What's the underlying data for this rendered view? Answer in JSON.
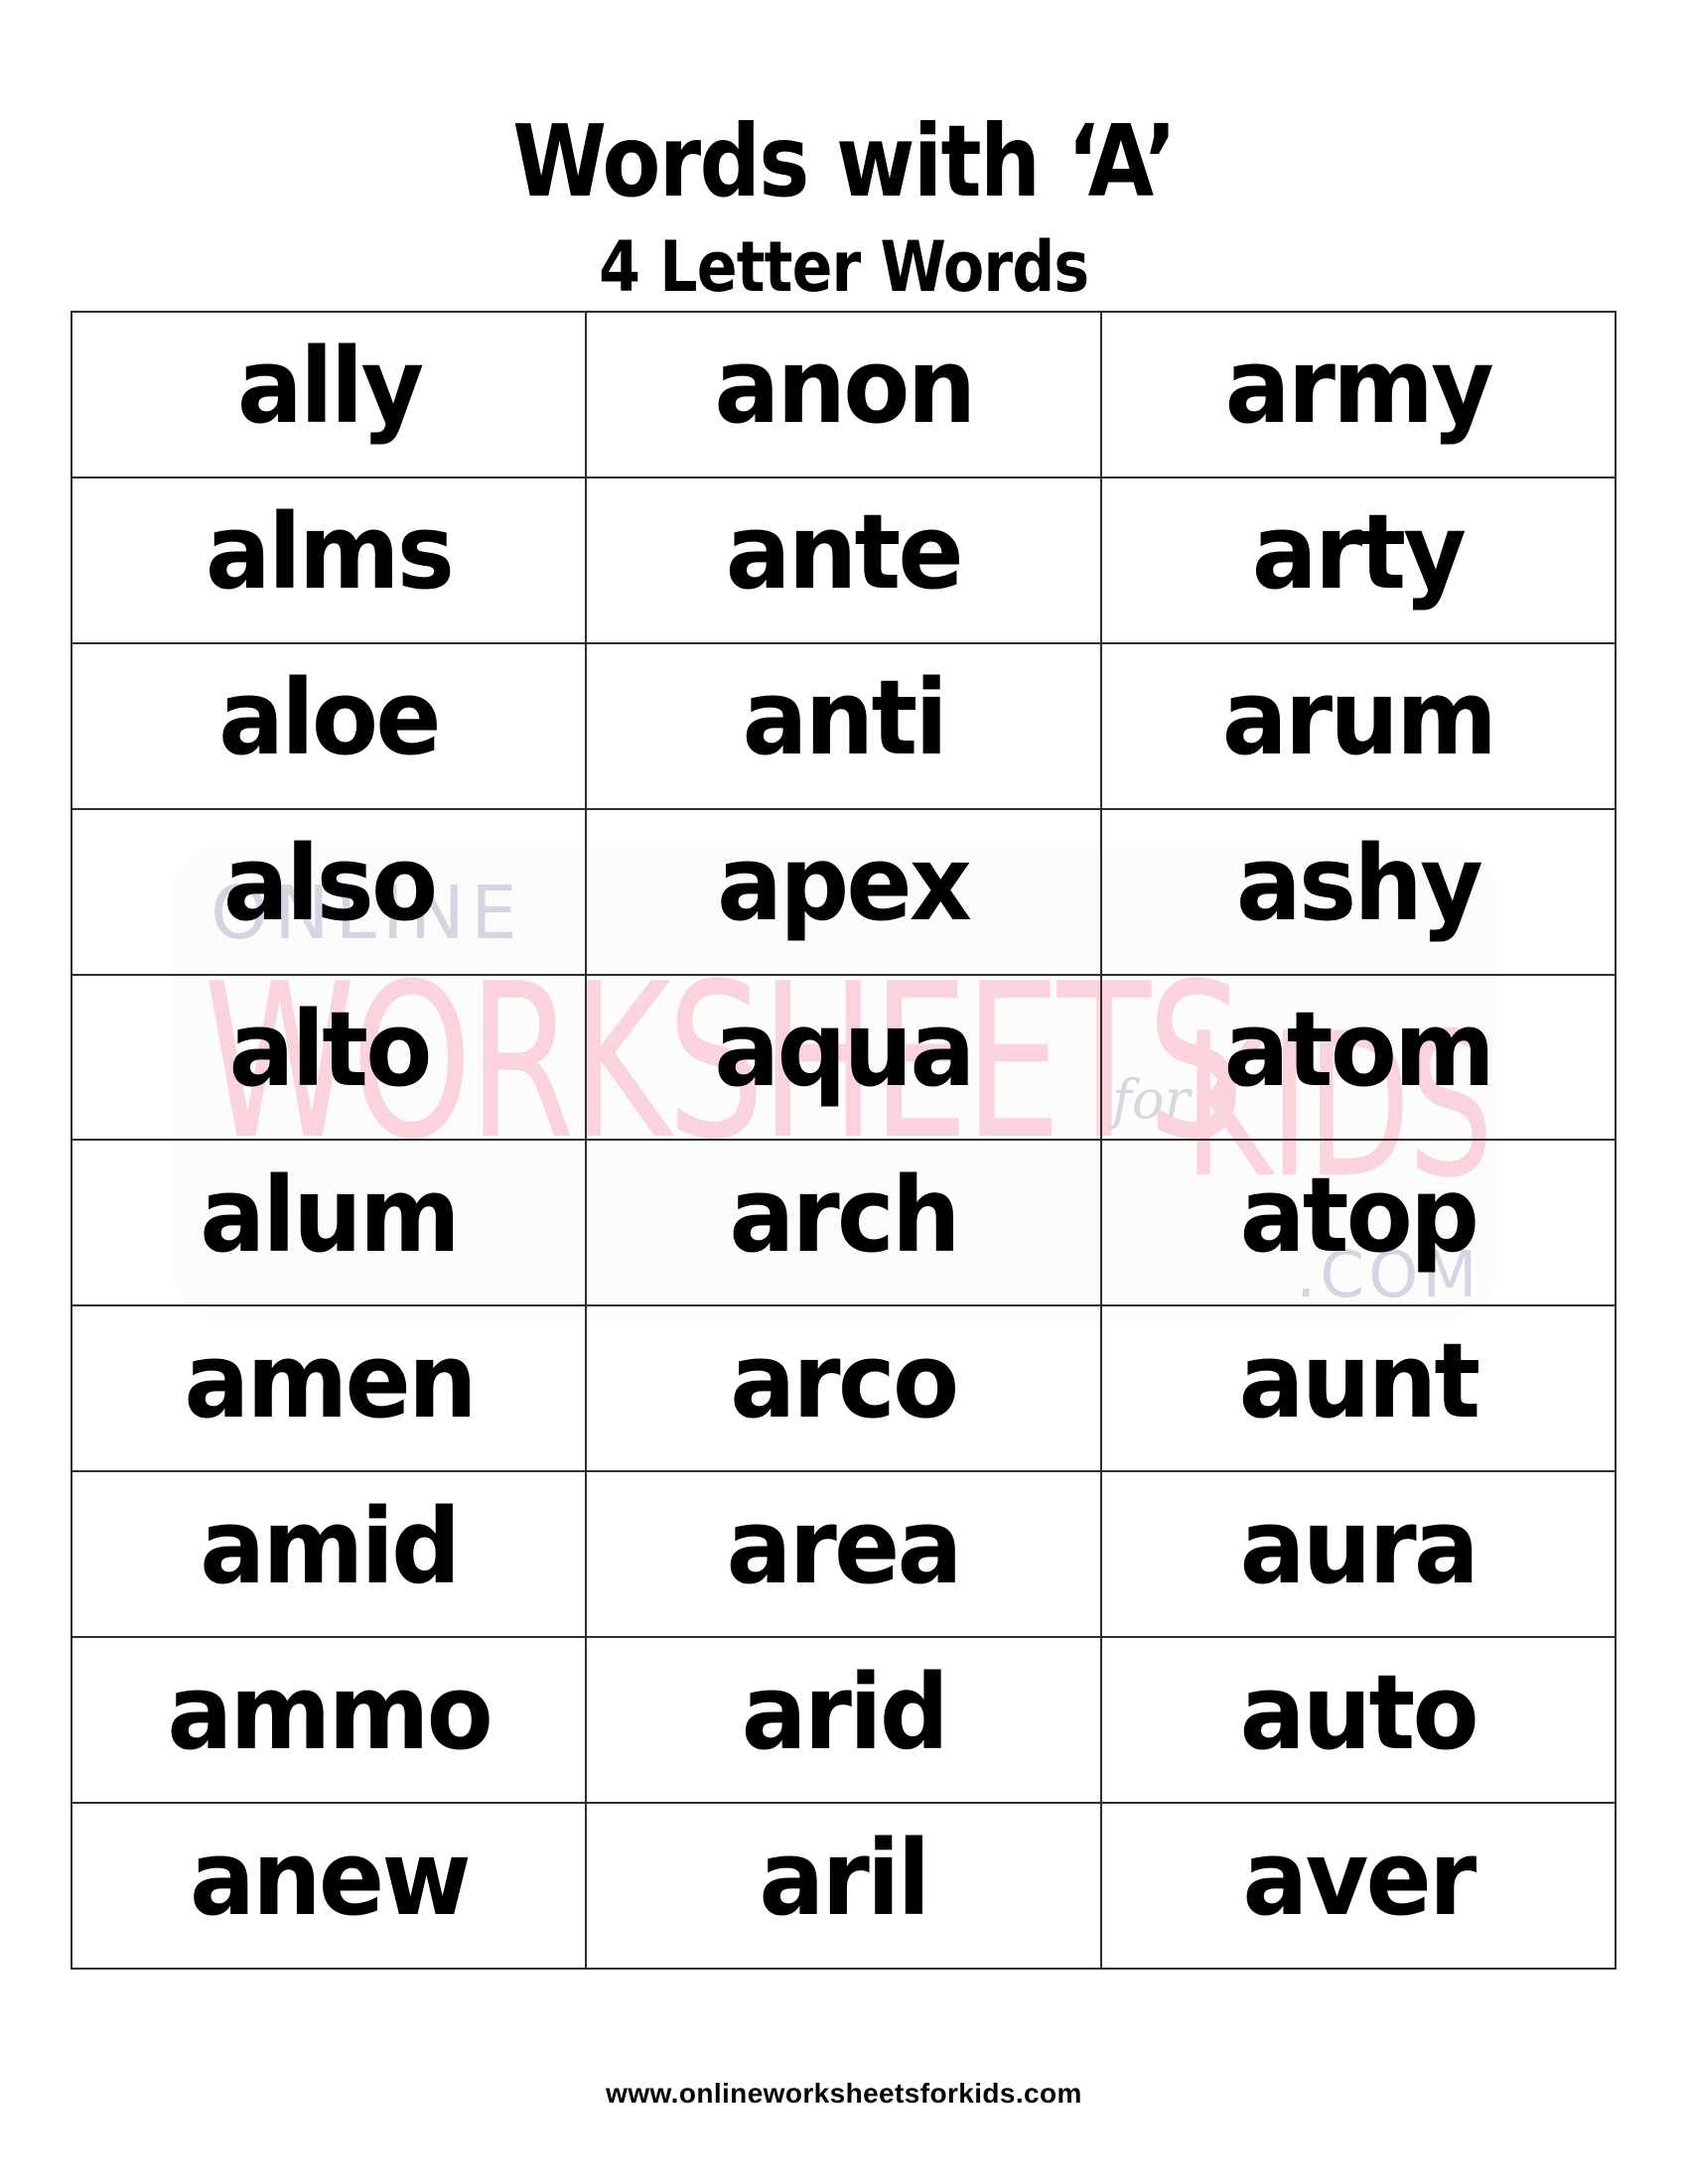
{
  "header": {
    "title": "Words with ‘A’",
    "subtitle": "4 Letter Words"
  },
  "watermark": {
    "line1": "ONLINE",
    "line2": "WORKSHEETS",
    "connector": "for",
    "line3": "KIDS",
    "suffix": ".COM",
    "colors": {
      "gray": "#d3d6e2",
      "pink": "#fad3dd"
    }
  },
  "table": {
    "columns": 3,
    "rows": [
      [
        "ally",
        "anon",
        "army"
      ],
      [
        "alms",
        "ante",
        "arty"
      ],
      [
        "aloe",
        "anti",
        "arum"
      ],
      [
        "also",
        "apex",
        "ashy"
      ],
      [
        "alto",
        "aqua",
        "atom"
      ],
      [
        "alum",
        "arch",
        "atop"
      ],
      [
        "amen",
        "arco",
        "aunt"
      ],
      [
        "amid",
        "area",
        "aura"
      ],
      [
        "ammo",
        "arid",
        "auto"
      ],
      [
        "anew",
        "aril",
        "aver"
      ]
    ]
  },
  "footer": {
    "url_text": "www.onlineworksheetsforkids.com"
  }
}
